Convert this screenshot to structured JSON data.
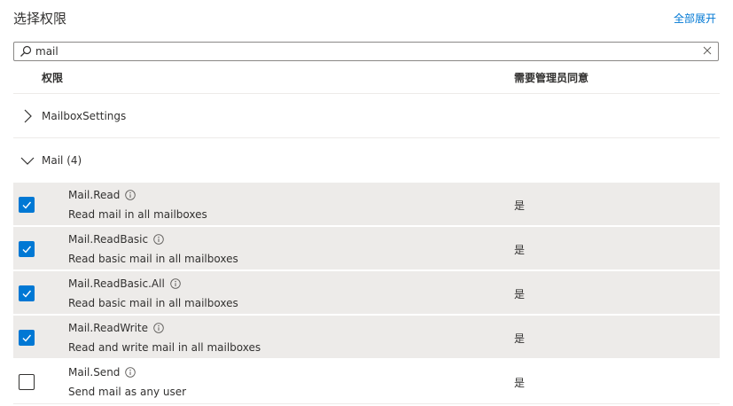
{
  "panel": {
    "title": "选择权限",
    "expand_all_label": "全部展开"
  },
  "search": {
    "value": "mail",
    "icon": "search-icon",
    "clear_icon": "close-icon"
  },
  "table_headers": {
    "permission": "权限",
    "admin_consent": "需要管理员同意"
  },
  "groups": [
    {
      "label": "MailboxSettings",
      "expanded": false
    },
    {
      "label": "Mail (4)",
      "expanded": true
    }
  ],
  "permissions": [
    {
      "name": "Mail.Read",
      "description": "Read mail in all mailboxes",
      "admin_consent": "是",
      "checked": true
    },
    {
      "name": "Mail.ReadBasic",
      "description": "Read basic mail in all mailboxes",
      "admin_consent": "是",
      "checked": true
    },
    {
      "name": "Mail.ReadBasic.All",
      "description": "Read basic mail in all mailboxes",
      "admin_consent": "是",
      "checked": true
    },
    {
      "name": "Mail.ReadWrite",
      "description": "Read and write mail in all mailboxes",
      "admin_consent": "是",
      "checked": true
    },
    {
      "name": "Mail.Send",
      "description": "Send mail as any user",
      "admin_consent": "是",
      "checked": false
    }
  ],
  "colors": {
    "accent": "#0078d4",
    "selected_row_bg": "#edebe9",
    "text": "#323130",
    "divider": "#edebe9"
  }
}
